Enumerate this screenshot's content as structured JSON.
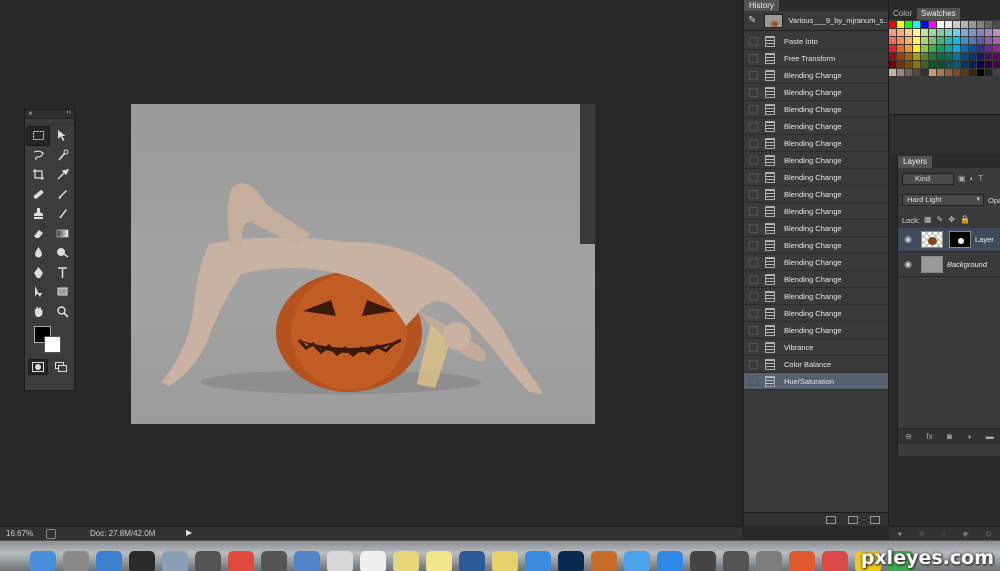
{
  "status": {
    "zoom": "16.67%",
    "doc_info": "Doc: 27.8M/42.0M",
    "arrow": "▶"
  },
  "tools_panel": {
    "close": "×",
    "collapse": "‹‹"
  },
  "history": {
    "tab_label": "History",
    "snapshot_label": "Various___9_by_mjranum_s...",
    "items": [
      {
        "label": "Paste Into"
      },
      {
        "label": "Free Transform"
      },
      {
        "label": "Blending Change"
      },
      {
        "label": "Blending Change"
      },
      {
        "label": "Blending Change"
      },
      {
        "label": "Blending Change"
      },
      {
        "label": "Blending Change"
      },
      {
        "label": "Blending Change"
      },
      {
        "label": "Blending Change"
      },
      {
        "label": "Blending Change"
      },
      {
        "label": "Blending Change"
      },
      {
        "label": "Blending Change"
      },
      {
        "label": "Blending Change"
      },
      {
        "label": "Blending Change"
      },
      {
        "label": "Blending Change"
      },
      {
        "label": "Blending Change"
      },
      {
        "label": "Blending Change"
      },
      {
        "label": "Blending Change"
      },
      {
        "label": "Vibrance"
      },
      {
        "label": "Color Balance"
      },
      {
        "label": "Hue/Saturation",
        "selected": true
      }
    ]
  },
  "swatches_panel": {
    "tab_color": "Color",
    "tab_swatches": "Swatches"
  },
  "layers": {
    "tab_label": "Layers",
    "filter_label": "Kind",
    "blend_mode": "Hard Light",
    "opacity_label": "Opa",
    "lock_label": "Lock:",
    "items": [
      {
        "name": "Layer",
        "selected": true,
        "has_mask": true
      },
      {
        "name": "Background",
        "selected": false
      }
    ],
    "footer_icons": [
      "link-icon",
      "fx-icon",
      "mask-icon",
      "adjustment-icon",
      "folder-icon"
    ]
  },
  "dock": {
    "watermark": "pxleyes.com"
  },
  "colors": {
    "panel_bg": "#3a3a3a",
    "app_bg": "#282828",
    "history_selected": "#56606e",
    "foreground_color": "#000000",
    "background_color": "#ffffff"
  }
}
